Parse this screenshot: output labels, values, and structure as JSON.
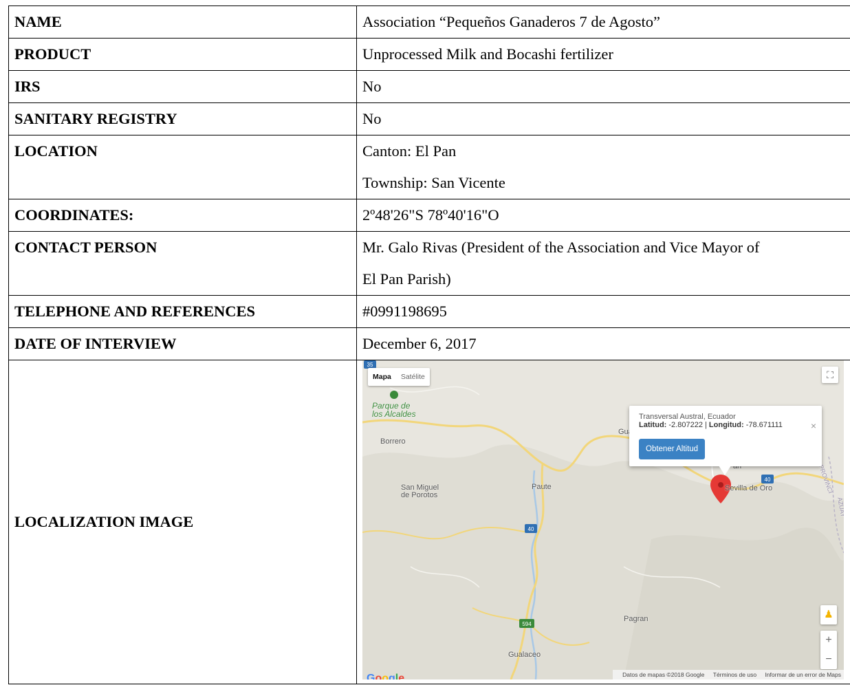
{
  "rows": {
    "name": {
      "label": "NAME",
      "value": "Association “Pequeños Ganaderos 7 de Agosto”"
    },
    "product": {
      "label": "PRODUCT",
      "value": "Unprocessed Milk and Bocashi fertilizer"
    },
    "irs": {
      "label": "IRS",
      "value": "No"
    },
    "sanitary": {
      "label": "SANITARY REGISTRY",
      "value": "No"
    },
    "location": {
      "label": "LOCATION",
      "line1": "Canton: El Pan",
      "line2": "Township: San Vicente"
    },
    "coordinates": {
      "label": "COORDINATES:",
      "value": "2º48'26\"S 78º40'16\"O"
    },
    "contact": {
      "label": "CONTACT PERSON",
      "line1": "Mr. Galo Rivas (President of the Association and Vice Mayor of",
      "line2": "El Pan Parish)"
    },
    "telephone": {
      "label": "TELEPHONE AND REFERENCES",
      "value": "#0991198695"
    },
    "date": {
      "label": "DATE OF INTERVIEW",
      "value": "December 6, 2017"
    },
    "localization": {
      "label": "LOCALIZATION IMAGE"
    }
  },
  "map": {
    "type_map": "Mapa",
    "type_satellite": "Satélite",
    "places": {
      "park": "Parque de\nlos Alcaldes",
      "borrero": "Borrero",
      "san_miguel": "San Miguel\nde Porotos",
      "paute": "Paute",
      "gua": "Gua",
      "el_pan": "l Pan",
      "sevilla": "Sevilla de Oro",
      "pagran": "Pagran",
      "gualaceo": "Gualaceo",
      "provincia": "PROVINCI",
      "azuay": "AZUAY"
    },
    "road_shields": [
      "35",
      "40",
      "40",
      "594"
    ],
    "info": {
      "place": "Transversal Austral, Ecuador",
      "lat_label": "Latitud:",
      "lat": "-2.807222",
      "lon_label": "Longitud:",
      "lon": "-78.671111",
      "button": "Obtener Altitud",
      "close": "×"
    },
    "fullscreen": "⛶",
    "zoom_in": "+",
    "zoom_out": "−",
    "logo": {
      "g1": "G",
      "o1": "o",
      "o2": "o",
      "g2": "g",
      "l": "l",
      "e": "e"
    },
    "footer": {
      "data": "Datos de mapas ©2018 Google",
      "terms": "Términos de uso",
      "report": "Informar de un error de Maps"
    },
    "colors": {
      "land": "#e8e6df",
      "road": "#f2d67a",
      "river": "#a8c8e6",
      "pin": "#e53935",
      "button": "#3b82c4"
    }
  }
}
